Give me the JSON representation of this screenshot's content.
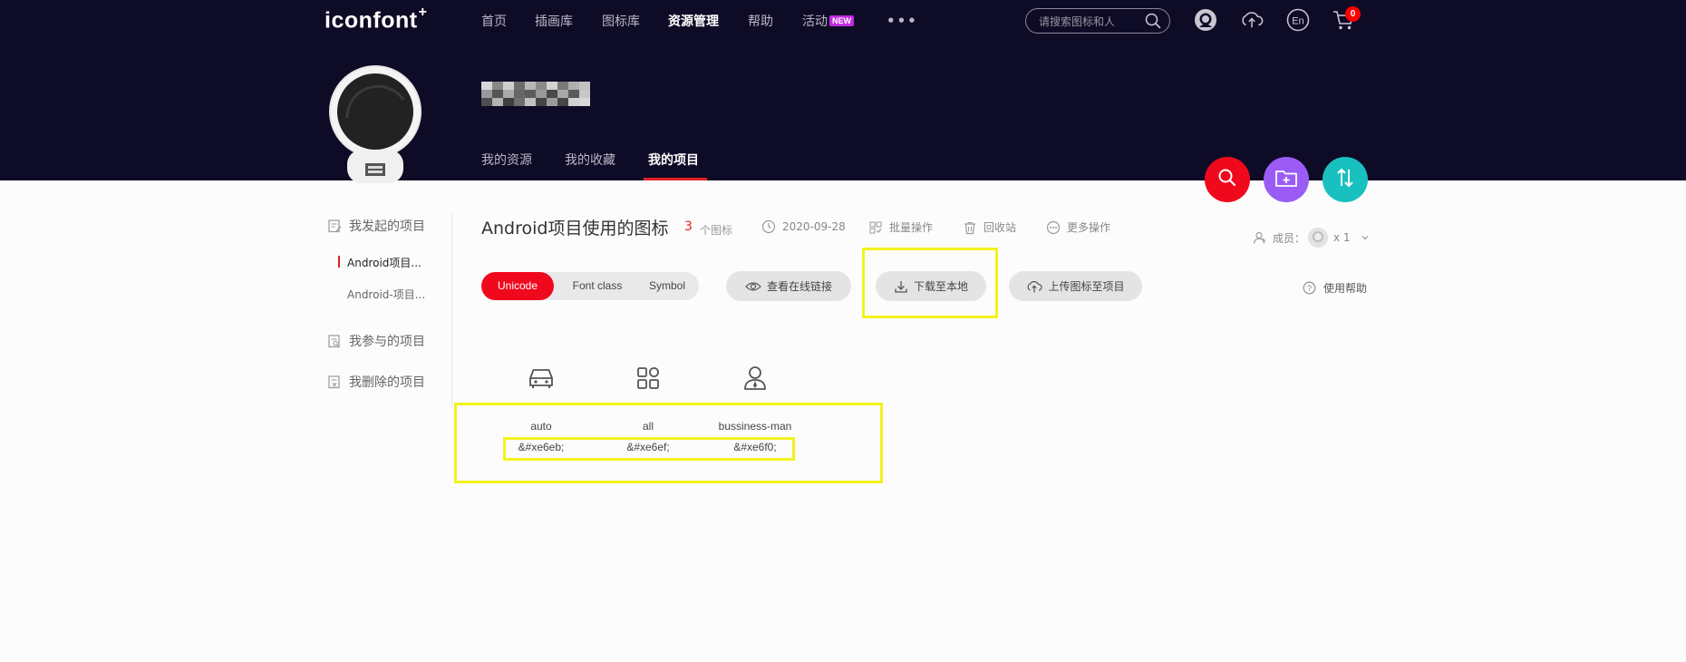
{
  "header": {
    "logo": "iconfont",
    "logo_mark": "+",
    "nav": [
      {
        "label": "首页"
      },
      {
        "label": "插画库"
      },
      {
        "label": "图标库"
      },
      {
        "label": "资源管理",
        "active": true
      },
      {
        "label": "帮助"
      },
      {
        "label": "活动",
        "badge": "NEW"
      }
    ],
    "more": "•••",
    "search_placeholder": "请搜索图标和人",
    "cart_count": "0",
    "icons": [
      "github-icon",
      "upload-cloud-icon",
      "language-en-icon",
      "cart-icon"
    ]
  },
  "profile": {
    "tabs": [
      {
        "label": "我的资源"
      },
      {
        "label": "我的收藏"
      },
      {
        "label": "我的项目",
        "active": true
      }
    ]
  },
  "fabs": [
    {
      "icon": "search-icon",
      "color": "#f0091d"
    },
    {
      "icon": "folder-add-icon",
      "color": "#9b5cf6"
    },
    {
      "icon": "sort-icon",
      "color": "#19c0c0"
    }
  ],
  "sidebar": {
    "started": "我发起的项目",
    "projects": [
      {
        "label": "Android项目...",
        "active": true
      },
      {
        "label": "Android-项目..."
      }
    ],
    "joined": "我参与的项目",
    "deleted": "我删除的项目"
  },
  "project": {
    "title": "Android项目使用的图标",
    "count": "3",
    "count_label": "个图标",
    "date": "2020-09-28",
    "batch": "批量操作",
    "trash": "回收站",
    "more": "更多操作",
    "members_label": "成员：",
    "members_count": "x 1",
    "formats": [
      "Unicode",
      "Font class",
      "Symbol"
    ],
    "active_format": "Unicode",
    "view_online": "查看在线链接",
    "download": "下载至本地",
    "upload": "上传图标至项目",
    "help": "使用帮助"
  },
  "icons": [
    {
      "name": "auto",
      "code": "&#xe6eb;",
      "glyph": "car-icon"
    },
    {
      "name": "all",
      "code": "&#xe6ef;",
      "glyph": "grid-icon"
    },
    {
      "name": "bussiness-man",
      "code": "&#xe6f0;",
      "glyph": "person-icon"
    }
  ],
  "colors": {
    "header_bg": "#0e0b26",
    "accent": "#f0091d",
    "highlight": "#f2f21f"
  }
}
